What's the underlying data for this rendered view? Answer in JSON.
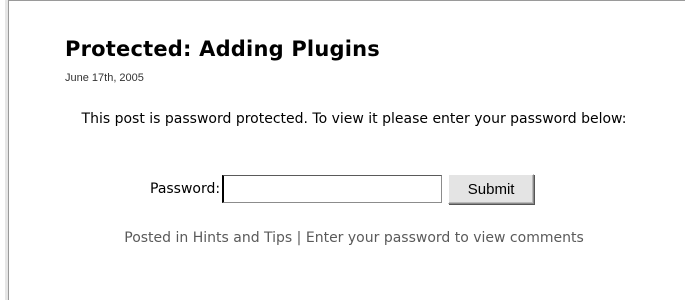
{
  "post": {
    "title": "Protected: Adding Plugins",
    "date": "June 17th, 2005",
    "protected_message": "This post is password protected. To view it please enter your password below:",
    "password_label": "Password:",
    "password_value": "",
    "submit_label": "Submit",
    "meta": {
      "prefix": "Posted in ",
      "category_link": "Hints and Tips",
      "separator": " | ",
      "comments_link": "Enter your password to view comments"
    }
  }
}
